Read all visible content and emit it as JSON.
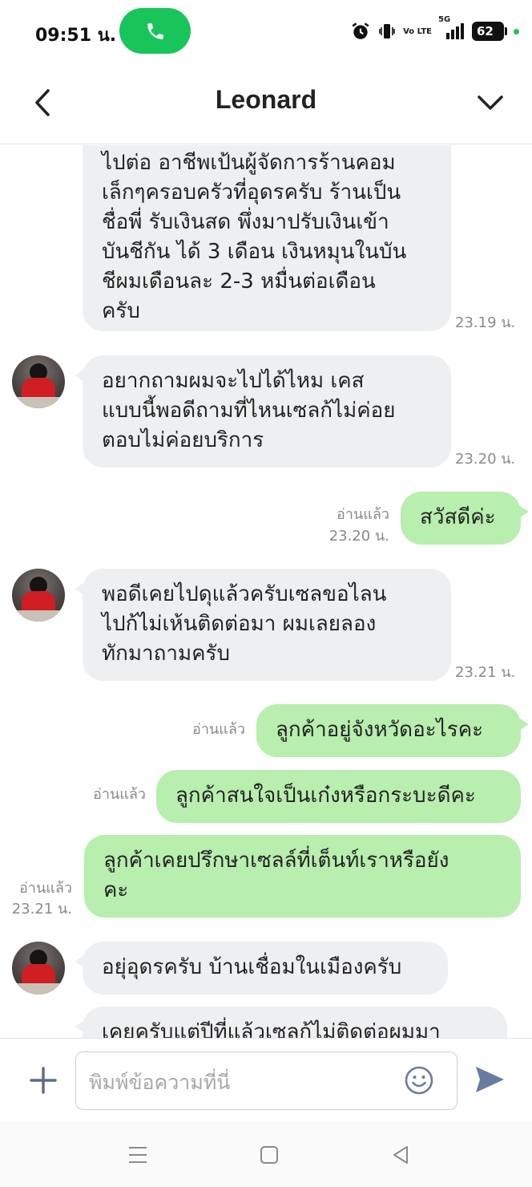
{
  "status_bar": {
    "time": "09:51 น.",
    "battery": "62",
    "network": "5G",
    "volte": "Vo LTE"
  },
  "header": {
    "contact_name": "Leonard"
  },
  "messages": [
    {
      "side": "in",
      "lines": [
        "ไปต่อ อาชีพเป้นผู้จัดการร้านคอม",
        "เล็กๆครอบครัวที่อุดรครับ ร้านเป็น",
        "ชื่อพี่ รับเงินสด พึ่งมาปรับเงินเข้า",
        "บันชีกัน ได้ 3 เดือน เงินหมุนในบัน",
        "ชีผมเดือนละ 2-3 หมื่นต่อเดือน",
        "ครับ"
      ],
      "time": "23.19 น."
    },
    {
      "side": "in",
      "lines": [
        "อยากถามผมจะไปได้ไหม เคส",
        "แบบนี้พอดีถามที่ไหนเซลก้ไม่ค่อย",
        "ตอบไม่ค่อยบริการ"
      ],
      "time": "23.20 น."
    },
    {
      "side": "out",
      "lines": [
        "สวัสดีค่ะ"
      ],
      "read": "อ่านแล้ว",
      "time": "23.20 น."
    },
    {
      "side": "in",
      "lines": [
        "พอดีเคยไปดุแล้วครับเซลขอไลน",
        "ไปก้ไม่เห้นติดต่อมา ผมเลยลอง",
        "ทักมาถามครับ"
      ],
      "time": "23.21 น."
    },
    {
      "side": "out",
      "lines": [
        "ลูกค้าอยู่จังหวัดอะไรคะ"
      ],
      "read": "อ่านแล้ว"
    },
    {
      "side": "out",
      "lines": [
        "ลูกค้าสนใจเป็นเก๋งหรือกระบะดีคะ"
      ],
      "read": "อ่านแล้ว"
    },
    {
      "side": "out",
      "lines": [
        "ลูกค้าเคยปรึกษาเซลล์ที่เต็นท์เราหรือยัง",
        "คะ"
      ],
      "read": "อ่านแล้ว",
      "time": "23.21 น."
    },
    {
      "side": "in",
      "lines": [
        "อยุ่อุดรครับ บ้านเชื่อมในเมืองครับ"
      ]
    },
    {
      "side": "in",
      "lines": [
        "เคยครับแต่ปีที่แล้วเซลก้ไม่ติดต่อผมมา"
      ]
    }
  ],
  "input": {
    "placeholder": "พิมพ์ข้อความที่นี่"
  },
  "colors": {
    "incoming_bubble": "#eeeff1",
    "outgoing_bubble": "#b8eeae",
    "call_pill": "#18c55a",
    "send_icon": "#6a7ba0"
  }
}
